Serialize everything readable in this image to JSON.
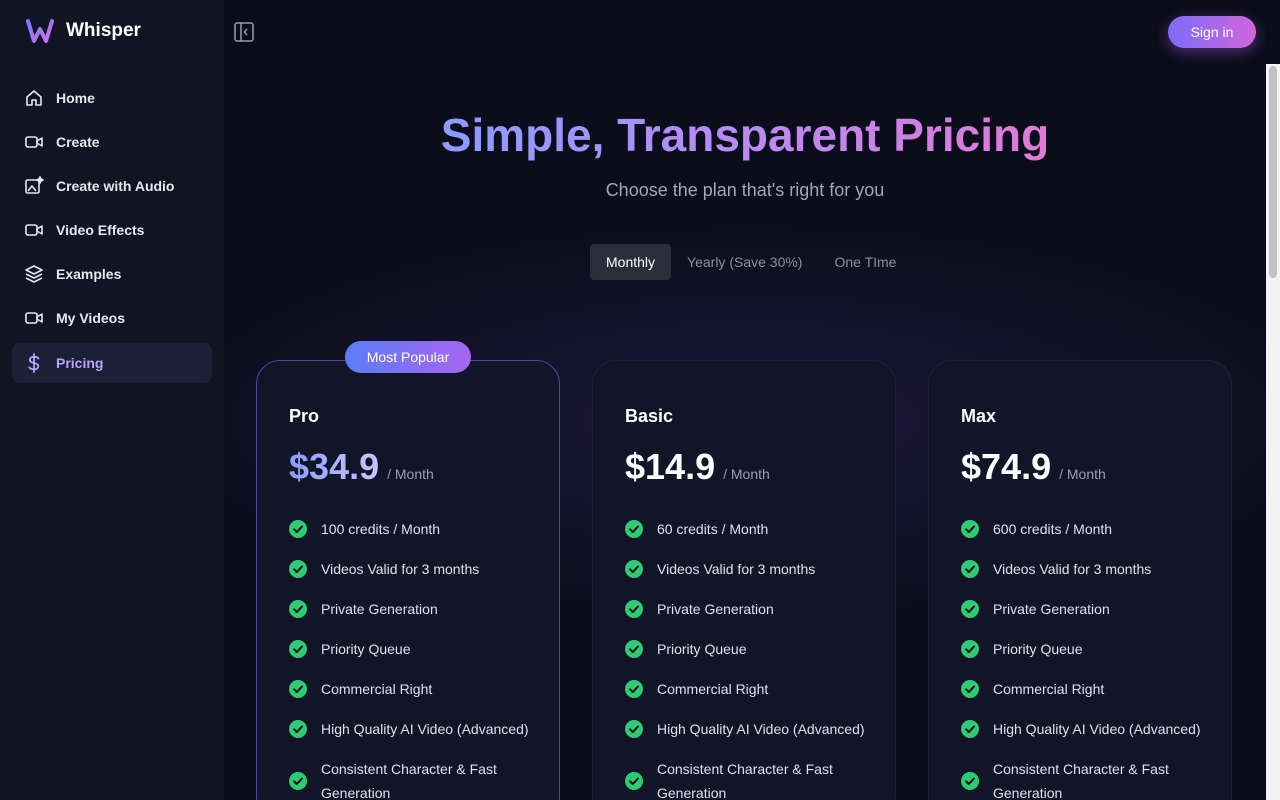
{
  "app": {
    "name": "Whisper"
  },
  "sidebar": {
    "items": [
      {
        "label": "Home",
        "icon": "home-icon"
      },
      {
        "label": "Create",
        "icon": "video-camera-icon"
      },
      {
        "label": "Create with Audio",
        "icon": "image-sparkle-icon"
      },
      {
        "label": "Video Effects",
        "icon": "video-camera-icon"
      },
      {
        "label": "Examples",
        "icon": "layers-icon"
      },
      {
        "label": "My Videos",
        "icon": "video-camera-icon"
      },
      {
        "label": "Pricing",
        "icon": "dollar-icon",
        "active": true
      }
    ]
  },
  "header": {
    "signin_label": "Sign in"
  },
  "hero": {
    "title": "Simple, Transparent Pricing",
    "subtitle": "Choose the plan that's right for you"
  },
  "billing_tabs": [
    {
      "label": "Monthly",
      "active": true
    },
    {
      "label": "Yearly (Save 30%)"
    },
    {
      "label": "One TIme"
    }
  ],
  "plans": [
    {
      "name": "Pro",
      "badge": "Most Popular",
      "price": "$34.9",
      "period": "/ Month",
      "features": [
        "100 credits / Month",
        "Videos Valid for 3 months",
        "Private Generation",
        "Priority Queue",
        "Commercial Right",
        "High Quality AI Video (Advanced)",
        "Consistent Character & Fast Generation"
      ]
    },
    {
      "name": "Basic",
      "price": "$14.9",
      "period": "/ Month",
      "features": [
        "60 credits / Month",
        "Videos Valid for 3 months",
        "Private Generation",
        "Priority Queue",
        "Commercial Right",
        "High Quality AI Video (Advanced)",
        "Consistent Character & Fast Generation"
      ]
    },
    {
      "name": "Max",
      "price": "$74.9",
      "period": "/ Month",
      "features": [
        "600 credits / Month",
        "Videos Valid for 3 months",
        "Private Generation",
        "Priority Queue",
        "Commercial Right",
        "High Quality AI Video (Advanced)",
        "Consistent Character & Fast Generation"
      ]
    }
  ],
  "colors": {
    "accent": "#b8a4ff",
    "check": "#2ecc71",
    "background": "#0b0d1a"
  }
}
